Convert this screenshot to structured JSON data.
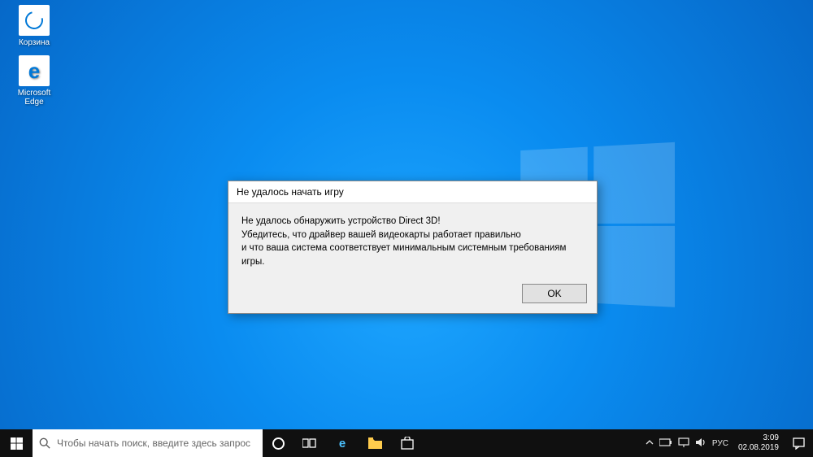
{
  "desktop": {
    "icons": {
      "recycle_bin": "Корзина",
      "edge": "Microsoft Edge"
    }
  },
  "dialog": {
    "title": "Не удалось начать игру",
    "line1": "Не удалось обнаружить устройство Direct 3D!",
    "line2": "Убедитесь, что драйвер вашей видеокарты работает правильно",
    "line3": "и что ваша система соответствует минимальным системным требованиям игры.",
    "ok_label": "OK"
  },
  "taskbar": {
    "search_placeholder": "Чтобы начать поиск, введите здесь запрос",
    "lang": "РУС",
    "time": "3:09",
    "date": "02.08.2019"
  }
}
